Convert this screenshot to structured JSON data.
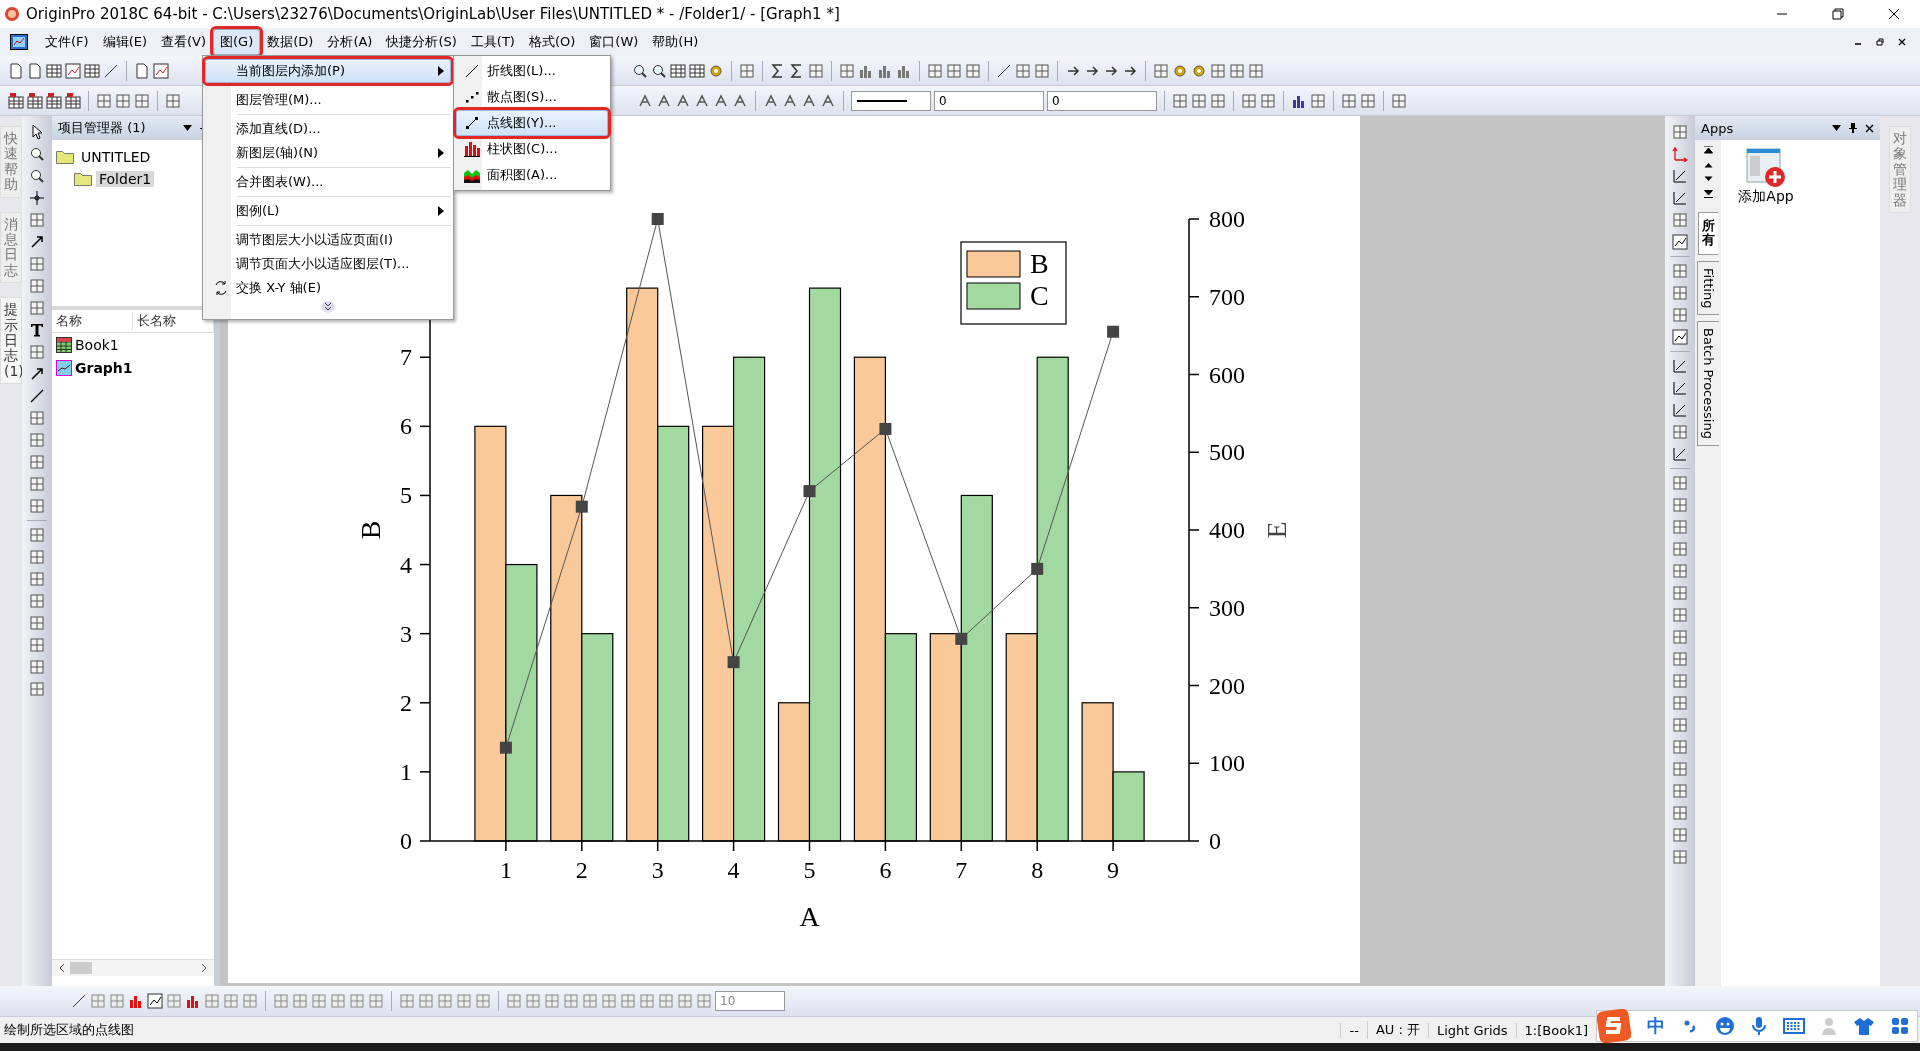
{
  "window": {
    "title": "OriginPro 2018C 64-bit - C:\\Users\\23276\\Documents\\OriginLab\\User Files\\UNTITLED * - /Folder1/ - [Graph1 *]"
  },
  "menu_bar": [
    {
      "label": "文件(F)",
      "selected": false,
      "outlined": false
    },
    {
      "label": "编辑(E)",
      "selected": false,
      "outlined": false
    },
    {
      "label": "查看(V)",
      "selected": false,
      "outlined": false
    },
    {
      "label": "图(G)",
      "selected": true,
      "outlined": true
    },
    {
      "label": "数据(D)",
      "selected": false,
      "outlined": false
    },
    {
      "label": "分析(A)",
      "selected": false,
      "outlined": false
    },
    {
      "label": "快捷分析(S)",
      "selected": false,
      "outlined": false
    },
    {
      "label": "工具(T)",
      "selected": false,
      "outlined": false
    },
    {
      "label": "格式(O)",
      "selected": false,
      "outlined": false
    },
    {
      "label": "窗口(W)",
      "selected": false,
      "outlined": false
    },
    {
      "label": "帮助(H)",
      "selected": false,
      "outlined": false
    }
  ],
  "graph_menu": [
    {
      "kind": "submenu",
      "label": "当前图层内添加(P)",
      "selected": true,
      "outlined": true
    },
    {
      "kind": "separator"
    },
    {
      "kind": "item",
      "label": "图层管理(M)...",
      "selected": false,
      "outlined": false
    },
    {
      "kind": "separator"
    },
    {
      "kind": "item",
      "label": "添加直线(D)...",
      "selected": false,
      "outlined": false
    },
    {
      "kind": "submenu",
      "label": "新图层(轴)(N)",
      "selected": false,
      "outlined": false
    },
    {
      "kind": "separator"
    },
    {
      "kind": "item",
      "label": "合并图表(W)...",
      "selected": false,
      "outlined": false
    },
    {
      "kind": "separator"
    },
    {
      "kind": "submenu",
      "label": "图例(L)",
      "selected": false,
      "outlined": false
    },
    {
      "kind": "separator"
    },
    {
      "kind": "item",
      "label": "调节图层大小以适应页面(I)",
      "selected": false,
      "outlined": false
    },
    {
      "kind": "item",
      "label": "调节页面大小以适应图层(T)...",
      "selected": false,
      "outlined": false
    },
    {
      "kind": "swap",
      "label": "交换 X-Y 轴(E)",
      "selected": false,
      "outlined": false
    },
    {
      "kind": "more"
    }
  ],
  "add_submenu": [
    {
      "kind": "line",
      "label": "折线图(L)...",
      "selected": false,
      "outlined": false
    },
    {
      "kind": "scatter",
      "label": "散点图(S)...",
      "selected": false,
      "outlined": false
    },
    {
      "kind": "line_symbol",
      "label": "点线图(Y)...",
      "selected": true,
      "outlined": true
    },
    {
      "kind": "column",
      "label": "柱状图(C)...",
      "selected": false,
      "outlined": false
    },
    {
      "kind": "area",
      "label": "面积图(A)...",
      "selected": false,
      "outlined": false
    }
  ],
  "format_toolbar": {
    "fields": [
      "0",
      "0"
    ]
  },
  "left_tabs": [
    {
      "label": "快速帮助",
      "selected": false
    },
    {
      "label": "消息日志",
      "selected": false
    },
    {
      "label": "提示日志 (1)",
      "selected": true
    }
  ],
  "project_explorer": {
    "title": "项目管理器 (1)",
    "tree": [
      {
        "label": "UNTITLED",
        "selected": false,
        "children": [
          {
            "label": "Folder1",
            "selected": true
          }
        ]
      }
    ],
    "columns": [
      "名称",
      "长名称"
    ],
    "files": [
      {
        "kind": "workbook",
        "name": "Book1",
        "active": false
      },
      {
        "kind": "graph",
        "name": "Graph1",
        "active": true
      }
    ]
  },
  "graph": {
    "chart_data": {
      "type": "bar",
      "xlabel": "A",
      "ylabel": "B",
      "categories": [
        "1",
        "2",
        "3",
        "4",
        "5",
        "6",
        "7",
        "8",
        "9"
      ],
      "series": [
        {
          "name": "B",
          "color": "#f9c99a",
          "values": [
            6,
            5,
            8,
            6,
            2,
            7,
            3,
            3,
            2
          ]
        },
        {
          "name": "C",
          "color": "#a2d9a0",
          "values": [
            4,
            3,
            6,
            7,
            8,
            3,
            5,
            7,
            1
          ]
        },
        {
          "name": "E",
          "type": "line",
          "axis": "y2",
          "marker": "square",
          "color": "#444444",
          "values": [
            120,
            430,
            800,
            230,
            450,
            530,
            260,
            350,
            655
          ]
        }
      ],
      "legend": "upper right",
      "ylim": [
        0,
        9
      ],
      "yticks": [
        0,
        1,
        2,
        3,
        4,
        5,
        6,
        7
      ],
      "y2lim": [
        0,
        800
      ],
      "y2ticks": [
        0,
        100,
        200,
        300,
        400,
        500,
        600,
        700,
        800
      ]
    }
  },
  "apps_panel": {
    "title": "Apps",
    "tabs": [
      {
        "label": "所有",
        "kind": "stacked",
        "selected": true
      },
      {
        "label": "Fitting",
        "kind": "rotated",
        "selected": false
      },
      {
        "label": "Batch Processing",
        "kind": "rotated",
        "selected": false
      }
    ],
    "apps": [
      {
        "label": "添加App"
      }
    ]
  },
  "right_tabs": [
    {
      "label": "对象管理器",
      "selected": false
    }
  ],
  "bottom_toolbar": {
    "fields": [
      "10"
    ]
  },
  "status_bar": {
    "message": "绘制所选区域的点线图",
    "fields": [
      "--",
      "AU : 开",
      "Light Grids",
      "1:[Book1]"
    ]
  },
  "ime_bar": {
    "mode": "中"
  }
}
